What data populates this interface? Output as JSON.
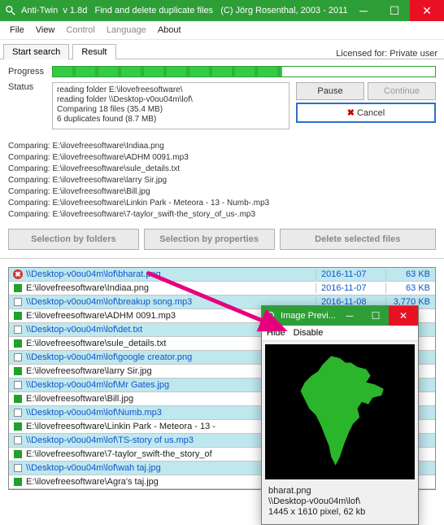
{
  "titlebar": {
    "app": "Anti-Twin",
    "version": "v 1.8d",
    "subtitle": "Find and delete duplicate files",
    "copyright": "(C) Jörg Rosenthal, 2003 - 2011"
  },
  "menu": {
    "file": "File",
    "view": "View",
    "control": "Control",
    "language": "Language",
    "about": "About"
  },
  "tabs": {
    "start": "Start search",
    "result": "Result",
    "license": "Licensed for: Private user"
  },
  "progress": {
    "label": "Progress"
  },
  "status": {
    "label": "Status",
    "lines": [
      "reading folder E:\\ilovefreesoftware\\",
      "reading folder \\\\Desktop-v0ou04m\\lof\\",
      "Comparing 18 files (35.4 MB)",
      "6 duplicates found (8.7 MB)"
    ]
  },
  "buttons": {
    "pause": "Pause",
    "continue": "Continue",
    "cancel": "Cancel"
  },
  "compare_prefix": "Comparing:",
  "compare": [
    "E:\\ilovefreesoftware\\Indiaa.png",
    "E:\\ilovefreesoftware\\ADHM 0091.mp3",
    "E:\\ilovefreesoftware\\sule_details.txt",
    "E:\\ilovefreesoftware\\larry Sir.jpg",
    "E:\\ilovefreesoftware\\Bill.jpg",
    "E:\\ilovefreesoftware\\Linkin Park - Meteora - 13 - Numb-.mp3",
    "E:\\ilovefreesoftware\\7-taylor_swift-the_story_of_us-.mp3"
  ],
  "actions": {
    "byfolders": "Selection by folders",
    "byprops": "Selection by properties",
    "delete": "Delete selected files"
  },
  "rows": [
    {
      "mark": "x",
      "path": "\\\\Desktop-v0ou04m\\lof\\bharat.png",
      "date": "2016-11-07",
      "size": "63 KB",
      "g": true,
      "link": true
    },
    {
      "mark": "g",
      "path": "E:\\ilovefreesoftware\\Indiaa.png",
      "date": "2016-11-07",
      "size": "63 KB"
    },
    {
      "mark": "w",
      "path": "\\\\Desktop-v0ou04m\\lof\\breakup song.mp3",
      "date": "2016-11-08",
      "size": "3,770 KB",
      "g": true,
      "link": true
    },
    {
      "mark": "g",
      "path": "E:\\ilovefreesoftware\\ADHM 0091.mp3"
    },
    {
      "mark": "w",
      "path": "\\\\Desktop-v0ou04m\\lof\\det.txt",
      "g": true,
      "link": true
    },
    {
      "mark": "g",
      "path": "E:\\ilovefreesoftware\\sule_details.txt"
    },
    {
      "mark": "w",
      "path": "\\\\Desktop-v0ou04m\\lof\\google creator.png",
      "g": true,
      "link": true
    },
    {
      "mark": "g",
      "path": "E:\\ilovefreesoftware\\larry Sir.jpg"
    },
    {
      "mark": "w",
      "path": "\\\\Desktop-v0ou04m\\lof\\Mr Gates.jpg",
      "g": true,
      "link": true
    },
    {
      "mark": "g",
      "path": "E:\\ilovefreesoftware\\Bill.jpg"
    },
    {
      "mark": "w",
      "path": "\\\\Desktop-v0ou04m\\lof\\Numb.mp3",
      "g": true,
      "link": true
    },
    {
      "mark": "g",
      "path": "E:\\ilovefreesoftware\\Linkin Park - Meteora - 13 -"
    },
    {
      "mark": "w",
      "path": "\\\\Desktop-v0ou04m\\lof\\TS-story of us.mp3",
      "g": true,
      "link": true
    },
    {
      "mark": "g",
      "path": "E:\\ilovefreesoftware\\7-taylor_swift-the_story_of"
    },
    {
      "mark": "w",
      "path": "\\\\Desktop-v0ou04m\\lof\\wah taj.jpg",
      "g": true,
      "link": true
    },
    {
      "mark": "g",
      "path": "E:\\ilovefreesoftware\\Agra's taj.jpg"
    }
  ],
  "preview": {
    "title": "Image Previ...",
    "hide": "Hide",
    "disable": "Disable",
    "filename": "bharat.png",
    "folder": "\\\\Desktop-v0ou04m\\lof\\",
    "dims": "1445 x 1610 pixel, 62 kb"
  }
}
